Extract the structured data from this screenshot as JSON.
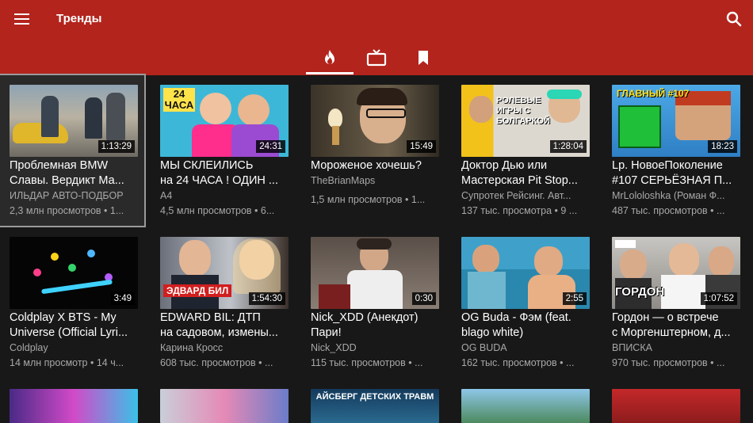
{
  "appbar": {
    "title": "Тренды",
    "menu_icon": "menu-icon",
    "search_icon": "search-icon",
    "color": "#b3241d"
  },
  "tabs": [
    {
      "name": "trending",
      "icon": "fire-icon",
      "active": true
    },
    {
      "name": "subscriptions",
      "icon": "tv-icon",
      "active": false
    },
    {
      "name": "library",
      "icon": "bookmark-icon",
      "active": false
    }
  ],
  "videos": [
    {
      "title1": "Проблемная BMW",
      "title2": "Славы. Вердикт Ма...",
      "channel": "ИЛЬДАР АВТО-ПОДБОР",
      "meta": "2,3 млн просмотров • 1...",
      "duration": "1:13:29"
    },
    {
      "title1": "МЫ СКЛЕИЛИСЬ",
      "title2": "на 24 ЧАСА ! ОДИН ...",
      "channel": "A4",
      "meta": "4,5 млн просмотров • 6...",
      "duration": "24:31",
      "thumb_text": "24 ЧАСА"
    },
    {
      "title1": "Мороженое хочешь?",
      "title2": "",
      "channel": "TheBrianMaps",
      "meta": "1,5 млн просмотров • 1...",
      "duration": "15:49"
    },
    {
      "title1": "Доктор Дью или",
      "title2": "Мастерская Pit Stop...",
      "channel": "Супротек Рейсинг. Авт...",
      "meta": "137 тыс. просмотра • 9 ...",
      "duration": "1:28:04",
      "thumb_text": "РОЛЕВЫЕ ИГРЫ С БОЛГАРКОЙ"
    },
    {
      "title1": "Lp. НовоеПоколение",
      "title2": "#107 СЕРЬЁЗНАЯ П...",
      "channel": "MrLololoshka (Роман Ф...",
      "meta": "487 тыс. просмотров • ...",
      "duration": "18:23",
      "thumb_text": "ГЛАВНЫЙ #107"
    },
    {
      "title1": "Coldplay X BTS - My",
      "title2": "Universe (Official Lyri...",
      "channel": "Coldplay",
      "meta": "14 млн просмотр • 14 ч...",
      "duration": "3:49"
    },
    {
      "title1": "EDWARD BIL: ДТП",
      "title2": "на садовом, измены...",
      "channel": "Карина Кросс",
      "meta": "608 тыс. просмотров • ...",
      "duration": "1:54:30",
      "thumb_text": "ЭДВАРД БИЛ"
    },
    {
      "title1": "Nick_XDD (Анекдот)",
      "title2": "Пари!",
      "channel": "Nick_XDD",
      "meta": "115 тыс. просмотров • ...",
      "duration": "0:30"
    },
    {
      "title1": "OG Buda - Фэм (feat.",
      "title2": "blago white)",
      "channel": "OG BUDA",
      "meta": "162 тыс. просмотров • ...",
      "duration": "2:55"
    },
    {
      "title1": "Гордон — о встрече",
      "title2": "с Моргенштерном, д...",
      "channel": "ВПИСКА",
      "meta": "970 тыс. просмотров • ...",
      "duration": "1:07:52",
      "thumb_text": "ГОРДОН"
    },
    {
      "title1": "",
      "title2": "",
      "channel": "",
      "meta": "",
      "duration": ""
    },
    {
      "title1": "",
      "title2": "",
      "channel": "",
      "meta": "",
      "duration": ""
    },
    {
      "title1": "",
      "title2": "",
      "channel": "",
      "meta": "",
      "duration": "",
      "thumb_text": "АЙСБЕРГ ДЕТСКИХ ТРАВМ"
    },
    {
      "title1": "",
      "title2": "",
      "channel": "",
      "meta": "",
      "duration": ""
    },
    {
      "title1": "",
      "title2": "",
      "channel": "",
      "meta": "",
      "duration": ""
    }
  ]
}
